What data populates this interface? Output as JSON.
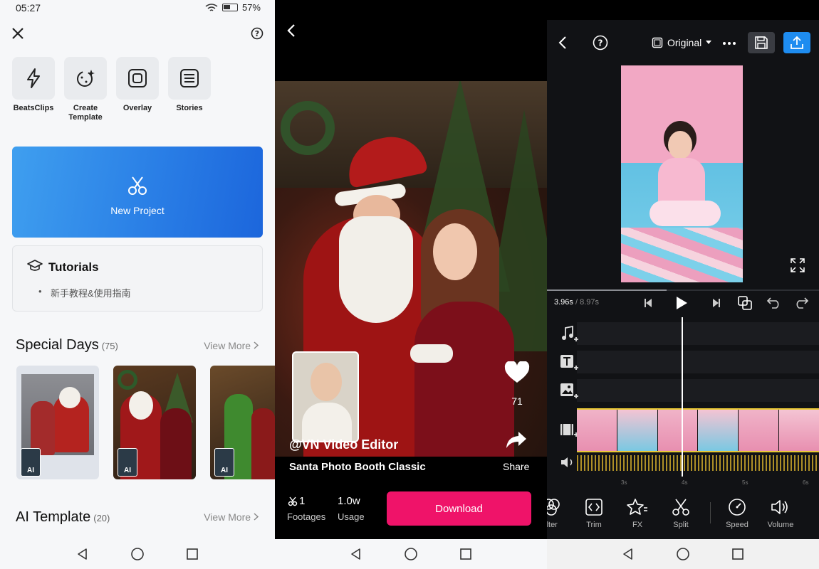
{
  "left_screen": {
    "status": {
      "time": "05:27",
      "battery": "57%"
    },
    "quick_actions": [
      {
        "label": "BeatsClips"
      },
      {
        "label": "Create Template"
      },
      {
        "label": "Overlay"
      },
      {
        "label": "Stories"
      }
    ],
    "new_project_label": "New Project",
    "tutorials": {
      "title": "Tutorials",
      "item": "新手教程&使用指南"
    },
    "special_days": {
      "title": "Special Days",
      "count": "(75)",
      "view_more": "View More"
    },
    "thumb_badge": "AI",
    "ai_template": {
      "title": "AI Template",
      "count": "(20)",
      "view_more": "View More"
    }
  },
  "middle_screen": {
    "watermark": "@VN Video Editor",
    "template_title": "Santa Photo Booth Classic",
    "likes": "71",
    "share_label": "Share",
    "footages": {
      "value": "1",
      "label": "Footages"
    },
    "usage": {
      "value": "1.0w",
      "label": "Usage"
    },
    "download_label": "Download"
  },
  "right_screen": {
    "ratio_label": "Original",
    "time_current": "3.96s",
    "time_total": "/ 8.97s",
    "ruler_ticks": [
      "3s",
      "4s",
      "5s",
      "6s"
    ],
    "tools": [
      {
        "label": "ilter"
      },
      {
        "label": "Trim"
      },
      {
        "label": "FX"
      },
      {
        "label": "Split"
      },
      {
        "label": "Speed"
      },
      {
        "label": "Volume"
      }
    ]
  },
  "colors": {
    "accent_blue": "#2a7fe6",
    "download_pink": "#ef1369",
    "export_blue": "#1e8cf0"
  }
}
